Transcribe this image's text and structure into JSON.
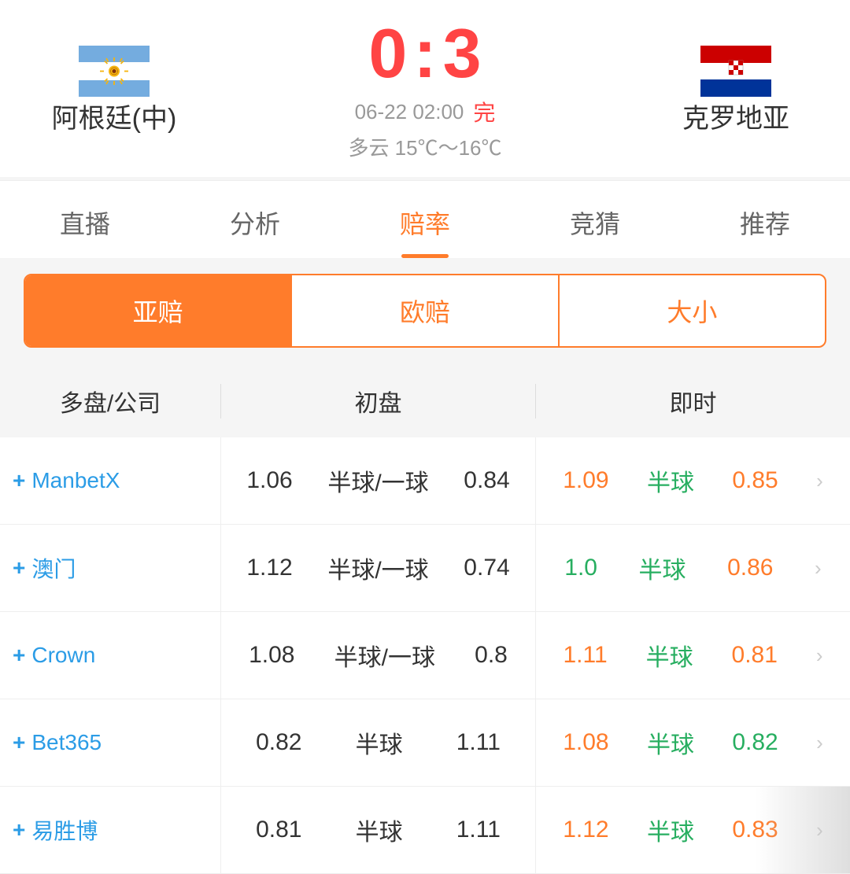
{
  "match": {
    "score_left": "0",
    "score_colon": ":",
    "score_right": "3",
    "date_time": "06-22 02:00",
    "status": "完",
    "weather": "多云  15℃～16℃",
    "team_left": "阿根廷(中)",
    "team_right": "克罗地亚"
  },
  "tabs": [
    {
      "label": "直播",
      "active": false
    },
    {
      "label": "分析",
      "active": false
    },
    {
      "label": "赔率",
      "active": true
    },
    {
      "label": "竞猜",
      "active": false
    },
    {
      "label": "推荐",
      "active": false
    }
  ],
  "subtabs": [
    {
      "label": "亚赔",
      "active": true
    },
    {
      "label": "欧赔",
      "active": false
    },
    {
      "label": "大小",
      "active": false
    }
  ],
  "table": {
    "header": {
      "company_col": "多盘/公司",
      "initial_col": "初盘",
      "live_col": "即时"
    },
    "rows": [
      {
        "company": "ManbetX",
        "initial_left": "1.06",
        "initial_mid": "半球/一球",
        "initial_right": "0.84",
        "live_left": "1.09",
        "live_left_color": "orange",
        "live_mid": "半球",
        "live_mid_color": "green",
        "live_right": "0.85",
        "live_right_color": "orange"
      },
      {
        "company": "澳门",
        "initial_left": "1.12",
        "initial_mid": "半球/一球",
        "initial_right": "0.74",
        "live_left": "1.0",
        "live_left_color": "green",
        "live_mid": "半球",
        "live_mid_color": "green",
        "live_right": "0.86",
        "live_right_color": "orange"
      },
      {
        "company": "Crown",
        "initial_left": "1.08",
        "initial_mid": "半球/一球",
        "initial_right": "0.8",
        "live_left": "1.11",
        "live_left_color": "orange",
        "live_mid": "半球",
        "live_mid_color": "green",
        "live_right": "0.81",
        "live_right_color": "orange"
      },
      {
        "company": "Bet365",
        "initial_left": "0.82",
        "initial_mid": "半球",
        "initial_right": "1.11",
        "live_left": "1.08",
        "live_left_color": "orange",
        "live_mid": "半球",
        "live_mid_color": "green",
        "live_right": "0.82",
        "live_right_color": "green"
      },
      {
        "company": "易胜博",
        "initial_left": "0.81",
        "initial_mid": "半球",
        "initial_right": "1.11",
        "live_left": "1.12",
        "live_left_color": "orange",
        "live_mid": "半球",
        "live_mid_color": "green",
        "live_right": "0.83",
        "live_right_color": "orange",
        "has_overlay": true
      }
    ]
  },
  "icons": {
    "plus": "+",
    "arrow_right": "›"
  }
}
